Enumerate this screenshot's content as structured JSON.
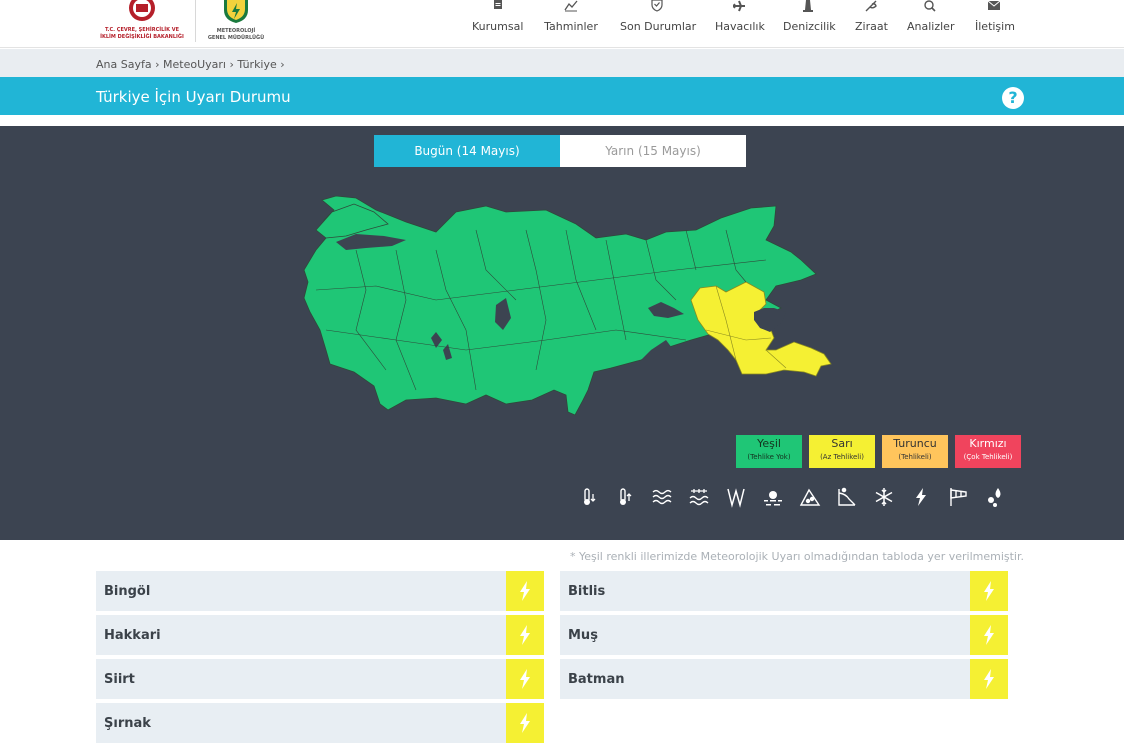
{
  "logos": {
    "ministry_lines": [
      "T.C. ÇEVRE, ŞEHİRCİLİK VE",
      "İKLİM DEĞİŞİKLİĞİ BAKANLIĞI"
    ],
    "mgm_lines": [
      "METEOROLOJİ",
      "GENEL MÜDÜRLÜĞÜ"
    ]
  },
  "nav": {
    "items": [
      {
        "label": "Kurumsal",
        "icon": "document-icon"
      },
      {
        "label": "Tahminler",
        "icon": "chart-icon"
      },
      {
        "label": "Son Durumlar",
        "icon": "shield-icon"
      },
      {
        "label": "Havacılık",
        "icon": "plane-icon"
      },
      {
        "label": "Denizcilik",
        "icon": "lighthouse-icon"
      },
      {
        "label": "Ziraat",
        "icon": "plant-icon"
      },
      {
        "label": "Analizler",
        "icon": "search-chart-icon"
      },
      {
        "label": "İletişim",
        "icon": "envelope-icon"
      }
    ]
  },
  "breadcrumb": {
    "home": "Ana Sayfa",
    "section": "MeteoUyarı",
    "current": "Türkiye",
    "sep": "›"
  },
  "page": {
    "title": "Türkiye İçin Uyarı Durumu",
    "help": "?"
  },
  "tabs": {
    "today": "Bugün (14 Mayıs)",
    "tomorrow": "Yarın (15 Mayıs)",
    "selected": "today"
  },
  "legend": {
    "green": {
      "label": "Yeşil",
      "sub": "(Tehlike Yok)",
      "color": "#1fc676"
    },
    "yellow": {
      "label": "Sarı",
      "sub": "(Az Tehlikeli)",
      "color": "#f5f033"
    },
    "orange": {
      "label": "Turuncu",
      "sub": "(Tehlikeli)",
      "color": "#ffc55c"
    },
    "red": {
      "label": "Kırmızı",
      "sub": "(Çok Tehlikeli)",
      "color": "#f0445d"
    }
  },
  "hazard_icons": [
    "temperature-low-icon",
    "temperature-high-icon",
    "wave-icon",
    "sea-storm-icon",
    "wind-gust-icon",
    "dust-icon",
    "avalanche-icon",
    "landslide-icon",
    "snowflake-icon",
    "lightning-icon",
    "windsock-icon",
    "hail-icon"
  ],
  "map": {
    "warned_provinces_color": "#f5f033",
    "default_color": "#1fc676",
    "lake_color": "#3c4451"
  },
  "note": "* Yeşil renkli illerimizde Meteorolojik Uyarı olmadığından tabloda yer verilmemiştir.",
  "warnings": {
    "left": [
      "Bingöl",
      "Hakkari",
      "Siirt",
      "Şırnak"
    ],
    "right": [
      "Bitlis",
      "Muş",
      "Batman"
    ],
    "level_color": "#f5f033",
    "icon": "lightning-icon"
  }
}
